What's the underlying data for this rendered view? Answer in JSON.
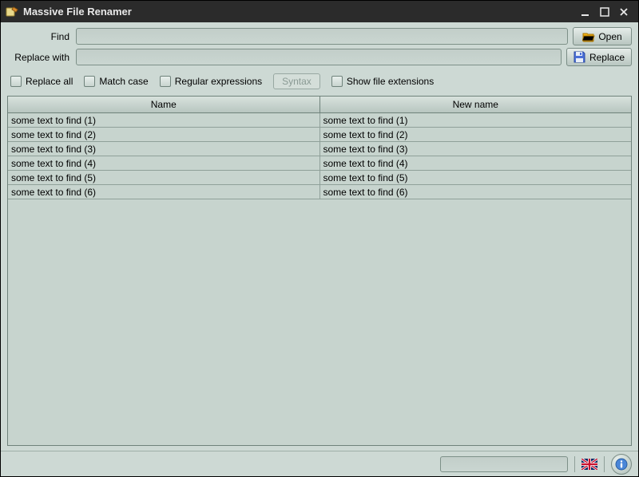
{
  "app_title": "Massive File Renamer",
  "labels": {
    "find": "Find",
    "replace_with": "Replace with"
  },
  "inputs": {
    "find_value": "",
    "replace_value": ""
  },
  "buttons": {
    "open": "Open",
    "replace": "Replace",
    "syntax": "Syntax"
  },
  "options": {
    "replace_all": "Replace all",
    "match_case": "Match case",
    "regex": "Regular expressions",
    "show_ext": "Show file extensions"
  },
  "table": {
    "headers": {
      "name": "Name",
      "new_name": "New name"
    },
    "rows": [
      {
        "name": "some text to find (1)",
        "new_name": "some text to find (1)"
      },
      {
        "name": "some text to find (2)",
        "new_name": "some text to find (2)"
      },
      {
        "name": "some text to find (3)",
        "new_name": "some text to find (3)"
      },
      {
        "name": "some text to find (4)",
        "new_name": "some text to find (4)"
      },
      {
        "name": "some text to find (5)",
        "new_name": "some text to find (5)"
      },
      {
        "name": "some text to find (6)",
        "new_name": "some text to find (6)"
      }
    ]
  },
  "status": {
    "text": ""
  },
  "icons": {
    "app": "rename-app-icon",
    "open": "folder-open-icon",
    "replace": "save-floppy-icon",
    "flag": "uk-flag-icon",
    "info": "info-icon"
  },
  "colors": {
    "panel": "#cdd9d4",
    "titlebar": "#2b2b2b",
    "border": "#7d9088",
    "accent_yellow": "#f4b414",
    "accent_blue": "#4a6fd6"
  }
}
